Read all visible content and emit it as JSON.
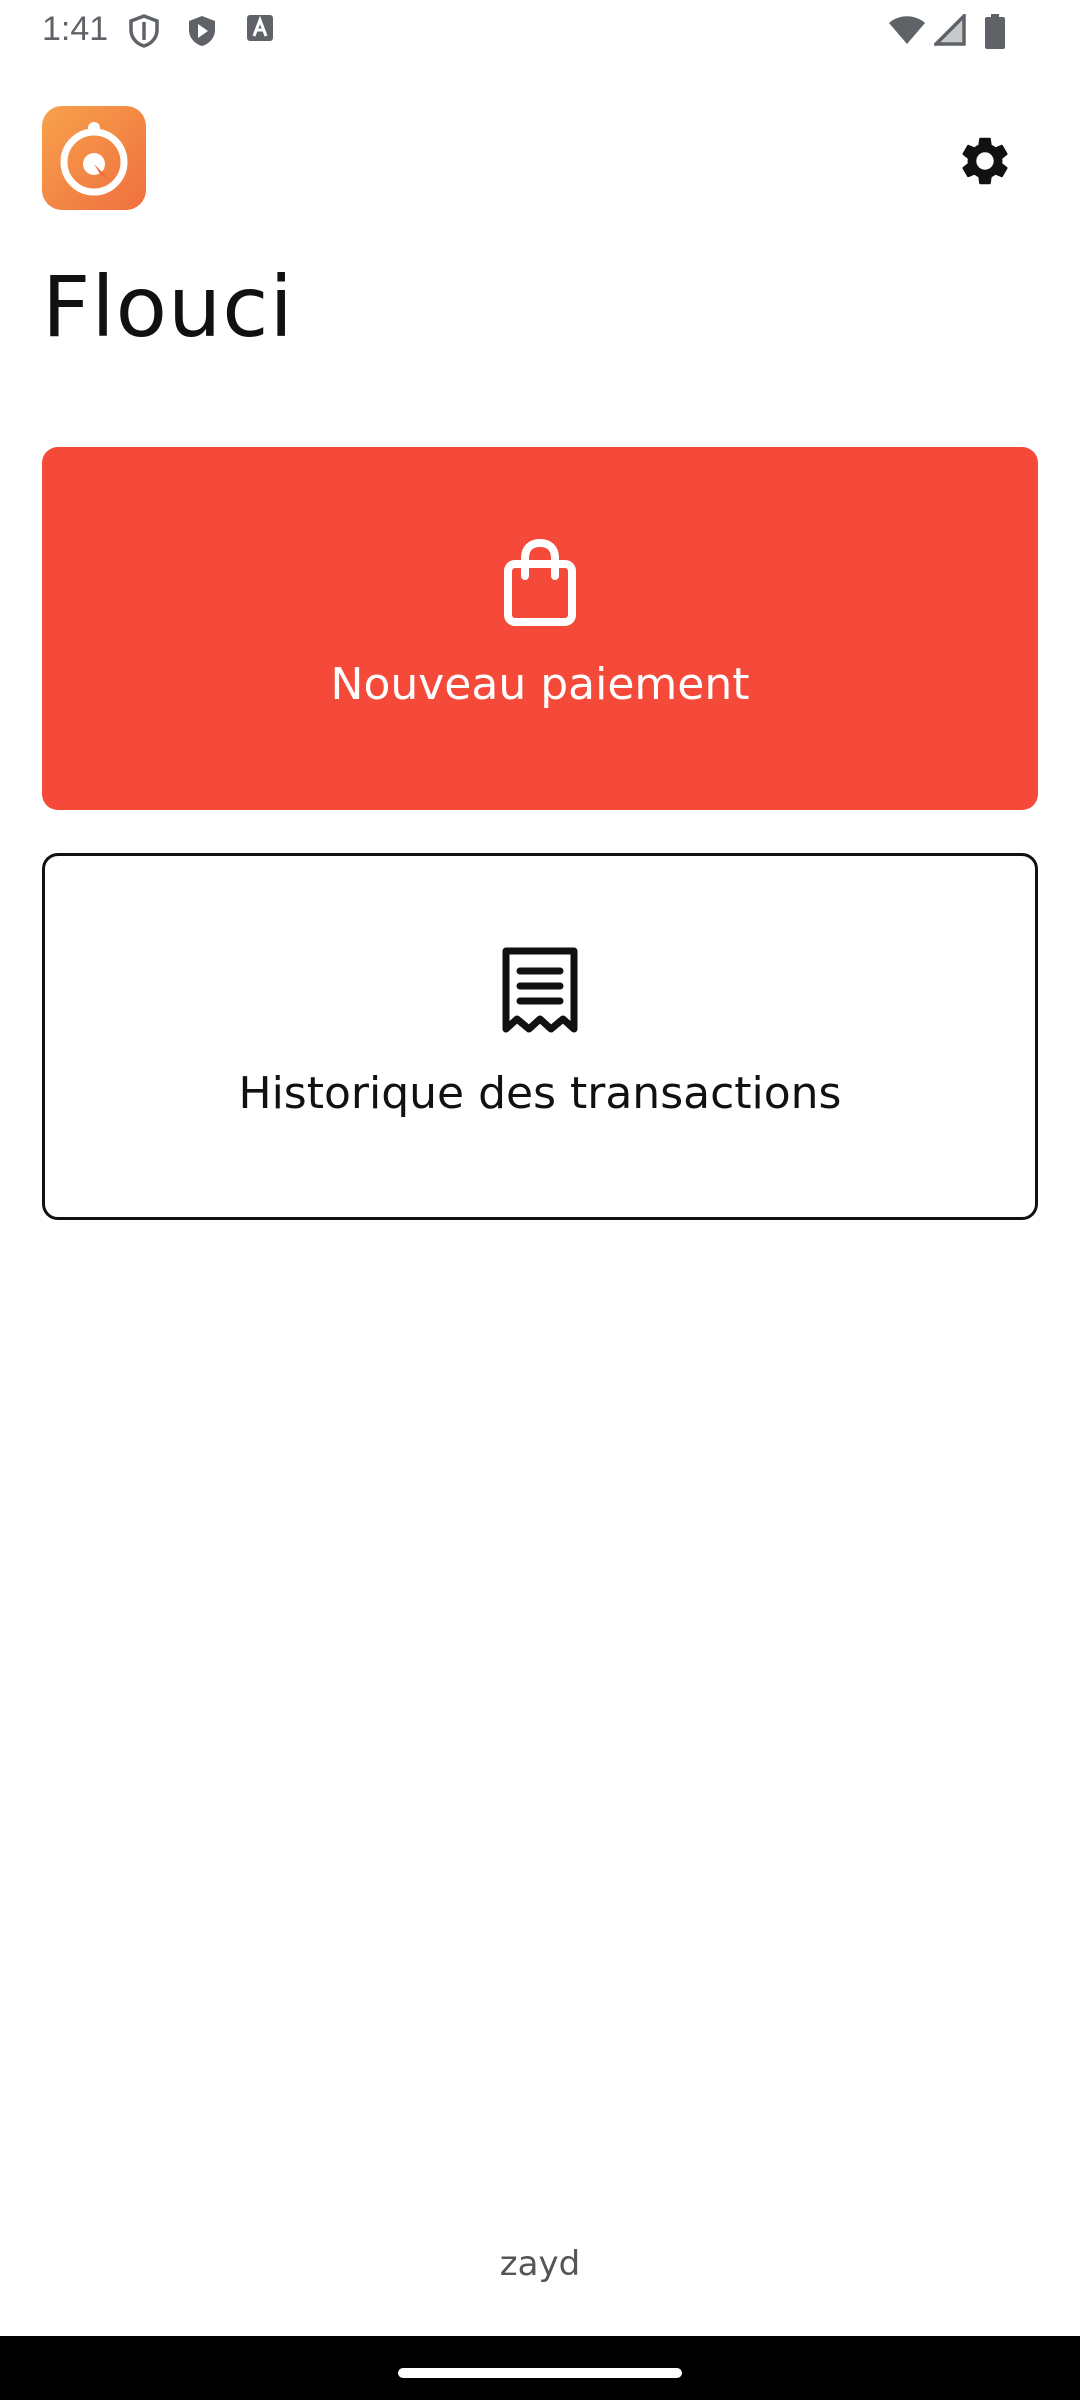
{
  "status_bar": {
    "time": "1:41",
    "icons_left": [
      "shield-outline-icon",
      "play-shield-icon",
      "keyboard-a-icon"
    ],
    "icons_right": [
      "wifi-icon",
      "signal-icon",
      "battery-icon"
    ]
  },
  "header": {
    "logo": "flouci-logo",
    "settings_icon": "gear-icon",
    "title": "Flouci"
  },
  "actions": {
    "new_payment": {
      "label": "Nouveau paiement",
      "icon": "shopping-bag-icon",
      "color": "#f5493a"
    },
    "history": {
      "label": "Historique des transactions",
      "icon": "receipt-icon"
    }
  },
  "footer": {
    "username": "zayd"
  },
  "colors": {
    "accent": "#f5493a",
    "logo_gradient_start": "#f7a24b",
    "logo_gradient_end": "#ef6f3f"
  }
}
